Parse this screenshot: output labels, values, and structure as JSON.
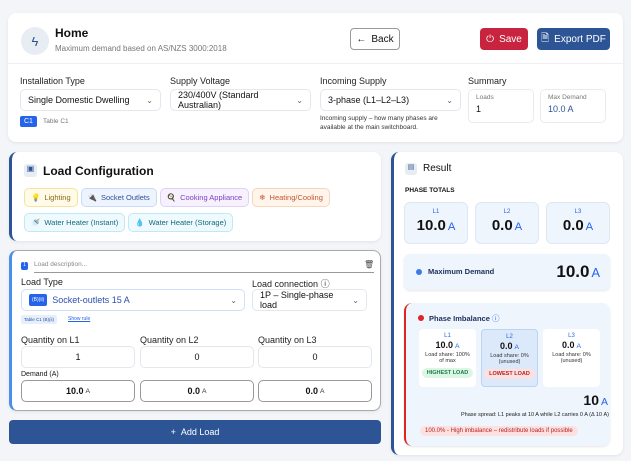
{
  "header": {
    "title": "Home",
    "subtitle": "Maximum demand based on AS/NZS 3000:2018",
    "back": "Back",
    "save": "Save",
    "export": "Export PDF"
  },
  "settings": {
    "installation_label": "Installation Type",
    "installation_value": "Single Domestic Dwelling",
    "table_badge": "C1",
    "table_text": "Table C1",
    "voltage_label": "Supply Voltage",
    "voltage_value": "230/400V (Standard Australian)",
    "supply_label": "Incoming Supply",
    "supply_value": "3-phase (L1–L2–L3)",
    "supply_help": "Incoming supply – how many phases are available at the main switchboard.",
    "summary_label": "Summary",
    "loads_label": "Loads",
    "loads_value": "1",
    "maxd_label": "Max Demand",
    "maxd_value": "10.0 A"
  },
  "load_config": {
    "title": "Load Configuration",
    "chips": [
      "Lighting",
      "Socket Outlets",
      "Cooking Appliance",
      "Heating/Cooling",
      "Water Heater (Instant)",
      "Water Heater (Storage)"
    ]
  },
  "load": {
    "index": "1",
    "desc_placeholder": "Load description...",
    "type_label": "Load Type",
    "type_badge": "(B)(ii)",
    "type_value": "Socket-outlets 15 A",
    "conn_label": "Load connection",
    "conn_value": "1P – Single-phase load",
    "table_ref": "Table C1 (B)(ii)",
    "show_rule": "Show rule",
    "qty_labels": [
      "Quantity on L1",
      "Quantity on L2",
      "Quantity on L3"
    ],
    "qty_values": [
      "1",
      "0",
      "0"
    ],
    "demand_label": "Demand (A)",
    "demand_values": [
      "10.0",
      "0.0",
      "0.0"
    ],
    "unit": "A"
  },
  "add_load": "Add Load",
  "result": {
    "title": "Result",
    "phase_totals": "PHASE TOTALS",
    "phases": [
      {
        "name": "L1",
        "value": "10.0"
      },
      {
        "name": "L2",
        "value": "0.0"
      },
      {
        "name": "L3",
        "value": "0.0"
      }
    ],
    "unit": "A",
    "max_demand_label": "Maximum Demand",
    "max_demand_value": "10.0"
  },
  "imbalance": {
    "title": "Phase Imbalance",
    "phases": [
      {
        "name": "L1",
        "value": "10.0",
        "share": "Load share: 100% of max",
        "tag": "HIGHEST LOAD"
      },
      {
        "name": "L2",
        "value": "0.0",
        "share": "Load share: 0% (unused)",
        "tag": "LOWEST LOAD"
      },
      {
        "name": "L3",
        "value": "0.0",
        "share": "Load share: 0% (unused)",
        "tag": ""
      }
    ],
    "spread_value": "10",
    "spread_text": "Phase spread: L1 peaks at 10 A while L2 carries 0 A (Δ 10 A)",
    "warning": "100.0% - High imbalance – redistribute loads if possible"
  },
  "colors": {
    "primary": "#2d5595",
    "save": "#c8243f",
    "accent": "#2563eb"
  }
}
